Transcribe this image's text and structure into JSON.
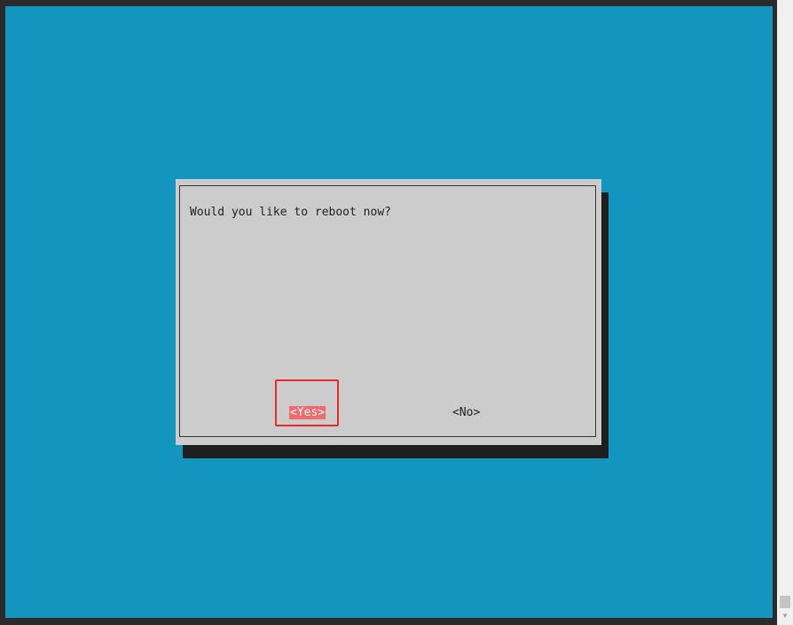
{
  "dialog": {
    "message": "Would you like to reboot now?",
    "buttons": {
      "yes_label": "<Yes>",
      "no_label": "<No>"
    },
    "selected_button": "yes"
  },
  "colors": {
    "terminal_background": "#1295be",
    "dialog_background": "#cccccc",
    "selected_button_background": "#f06b6b",
    "annotation_highlight": "#e8282a"
  },
  "icons": {
    "scroll_down": "triangle-down"
  }
}
